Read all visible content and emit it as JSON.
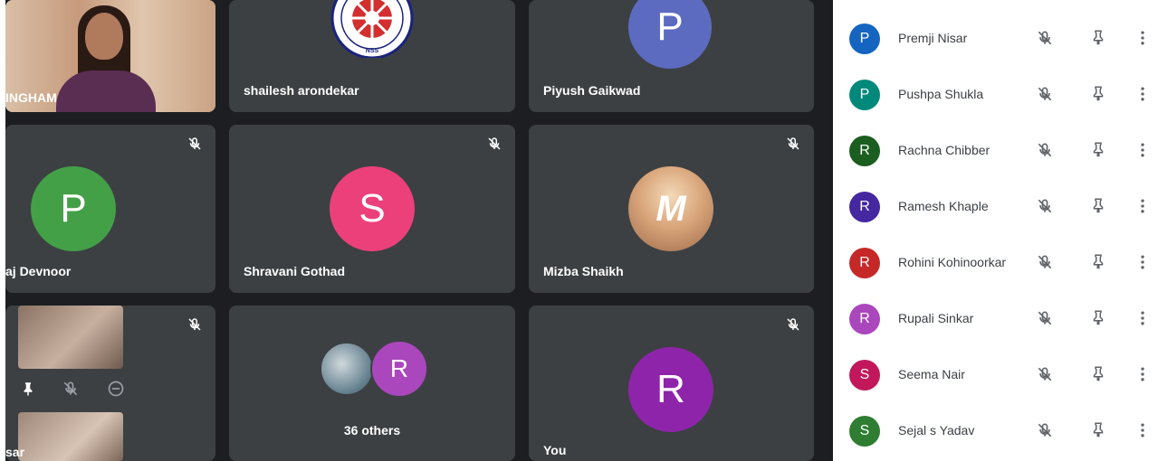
{
  "colors": {
    "tile_bg": "#3c4043",
    "page_bg": "#1d1e21",
    "panel_bg": "#ffffff"
  },
  "grid": {
    "presenter": {
      "name": "INGHAM"
    },
    "tiles": [
      {
        "name": "shailesh arondekar",
        "kind": "logo"
      },
      {
        "name": "Piyush Gaikwad",
        "initial": "P",
        "color": "#5c6bc0"
      },
      {
        "name": "aj Devnoor",
        "initial": "P",
        "color": "#43a047"
      },
      {
        "name": "Shravani Gothad",
        "initial": "S",
        "color": "#ec407a"
      },
      {
        "name": "Mizba Shaikh",
        "initial": "M"
      },
      {
        "name": "sar",
        "kind": "video"
      },
      {
        "name": "36 others",
        "initial": "R",
        "color": "#ab47bc"
      },
      {
        "name": "You",
        "initial": "R",
        "color": "#8e24aa"
      }
    ]
  },
  "people": [
    {
      "initial": "P",
      "name": "Premji Nisar",
      "color": "#1565c0"
    },
    {
      "initial": "P",
      "name": "Pushpa Shukla",
      "color": "#00897b"
    },
    {
      "initial": "R",
      "name": "Rachna Chibber",
      "color": "#1b5e20"
    },
    {
      "initial": "R",
      "name": "Ramesh Khaple",
      "color": "#4527a0"
    },
    {
      "initial": "R",
      "name": "Rohini Kohinoorkar",
      "color": "#c62828"
    },
    {
      "initial": "R",
      "name": "Rupali Sinkar",
      "color": "#ab47bc"
    },
    {
      "initial": "S",
      "name": "Seema Nair",
      "color": "#c2185b"
    },
    {
      "initial": "S",
      "name": "Sejal s Yadav",
      "color": "#2e7d32"
    }
  ]
}
